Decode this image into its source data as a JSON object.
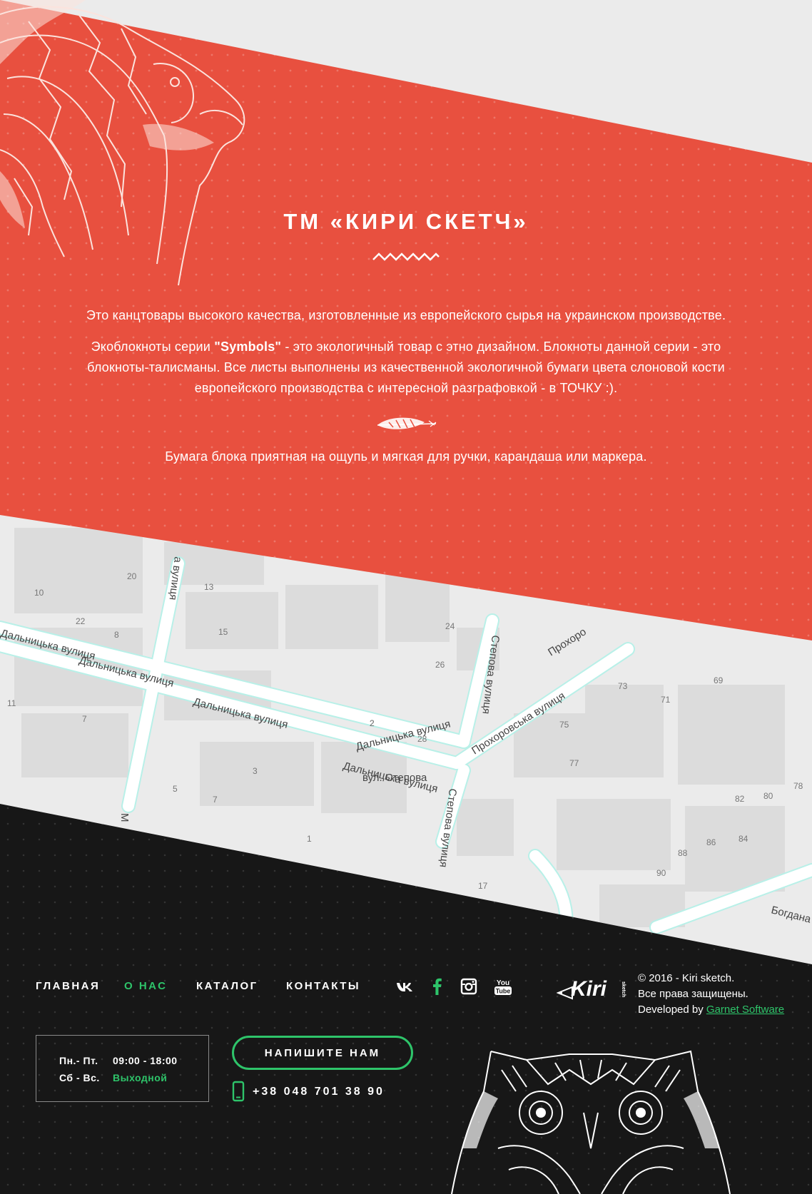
{
  "about": {
    "title": "ТМ «КИРИ СКЕТЧ»",
    "paragraph1": "Это канцтовары высокого качества, изготовленные из европейского сырья на украинском производстве.",
    "paragraph2_prefix": "Экоблокноты серии ",
    "paragraph2_bold": "\"Symbols\"",
    "paragraph2_suffix": " - это экологичный товар с этно дизайном. Блокноты данной серии - это блокноты-талисманы. Все листы выполнены из качественной экологичной бумаги цвета слоновой кости европейского производства с интересной разграфовкой - в ТОЧКУ :).",
    "paragraph3": "Бумага блока приятная на ощупь и мягкая для ручки, карандаша или маркера.",
    "accent_color": "#e8503f"
  },
  "map": {
    "streets": [
      "Дальницька вулиця",
      "Дальницька вулиця",
      "Дальницька вулиця",
      "Дальницька вулиця",
      "Дальницька вулиця",
      "Степова вулиця",
      "Степова вулиця",
      "Прохоровська вулиця",
      "Прохоро",
      "вул. Степова",
      "Богдана Хме",
      "М",
      "а вулиця"
    ],
    "house_numbers": [
      "20",
      "10",
      "22",
      "8",
      "2",
      "13",
      "15",
      "24",
      "26",
      "11",
      "7",
      "2",
      "28",
      "3",
      "5",
      "7",
      "1",
      "73",
      "71",
      "69",
      "75",
      "77",
      "78",
      "82",
      "80",
      "86",
      "84",
      "88",
      "90",
      "17"
    ]
  },
  "footer": {
    "nav": [
      {
        "label": "ГЛАВНАЯ",
        "active": false
      },
      {
        "label": "О НАС",
        "active": true
      },
      {
        "label": "КАТАЛОГ",
        "active": false
      },
      {
        "label": "КОНТАКТЫ",
        "active": false
      }
    ],
    "social": [
      "vk-icon",
      "facebook-icon",
      "instagram-icon",
      "youtube-icon"
    ],
    "youtube_text_top": "You",
    "youtube_text_bottom": "Tube",
    "logo_text": "Kiri",
    "logo_small_text": "sketch",
    "copyright_line1": "© 2016 - Kiri sketch.",
    "copyright_line2": "Все права защищены.",
    "developed_prefix": "Developed by ",
    "developer": "Garnet Software",
    "hours": {
      "weekdays_label": "Пн.- Пт.",
      "weekdays_value": "09:00 - 18:00",
      "weekend_label": "Сб - Вс.",
      "weekend_value": "Выходной"
    },
    "write_button": "НАПИШИТЕ НАМ",
    "phone": "+38 048 701 38 90",
    "accent_color": "#2ec46a"
  }
}
